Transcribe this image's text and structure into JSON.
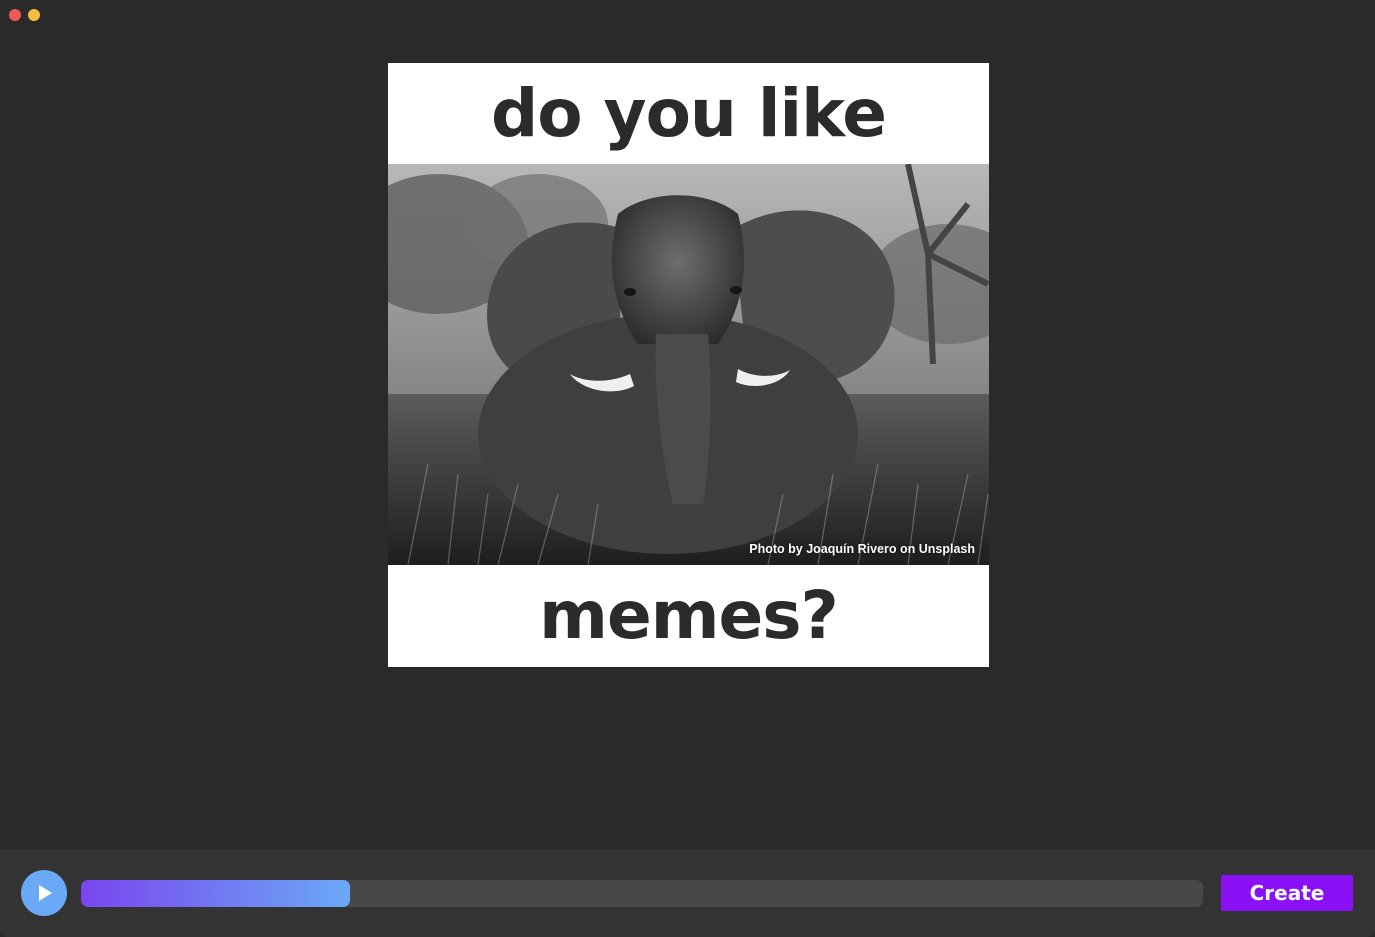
{
  "window": {
    "controls": [
      "close",
      "minimize"
    ],
    "colors": {
      "close": "#ed5b56",
      "minimize": "#f3bd41"
    }
  },
  "meme": {
    "top_text": "do you like",
    "bottom_text": "memes?",
    "image": {
      "subject": "elephant-photo",
      "credit": "Photo by Joaquín Rivero on Unsplash"
    }
  },
  "player": {
    "play_icon": "play-icon",
    "progress_percent": 24,
    "create_label": "Create",
    "colors": {
      "accent": "#8a10f5",
      "play": "#6aa9f6",
      "progress_start": "#7a45ef",
      "progress_end": "#6aa9f6"
    }
  }
}
